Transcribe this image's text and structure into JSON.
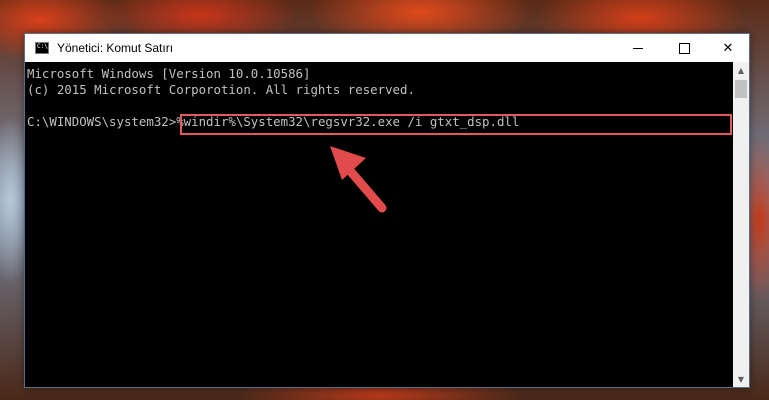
{
  "window": {
    "title": "Yönetici: Komut Satırı",
    "app_icon_text": "C:\\"
  },
  "console": {
    "line1": "Microsoft Windows [Version 10.0.10586]",
    "line2": "(c) 2015 Microsoft Corporotion. All rights reserved.",
    "prompt": "C:\\WINDOWS\\system32>",
    "command": "%windir%\\System32\\regsvr32.exe /i gtxt_dsp.dll"
  },
  "colors": {
    "highlight": "#e05a5a",
    "arrow": "#e24b4b"
  },
  "icons": [
    "console-app-icon",
    "minimize-icon",
    "maximize-icon",
    "close-icon",
    "scroll-up-icon",
    "scroll-down-icon",
    "arrow-pointer-icon"
  ]
}
